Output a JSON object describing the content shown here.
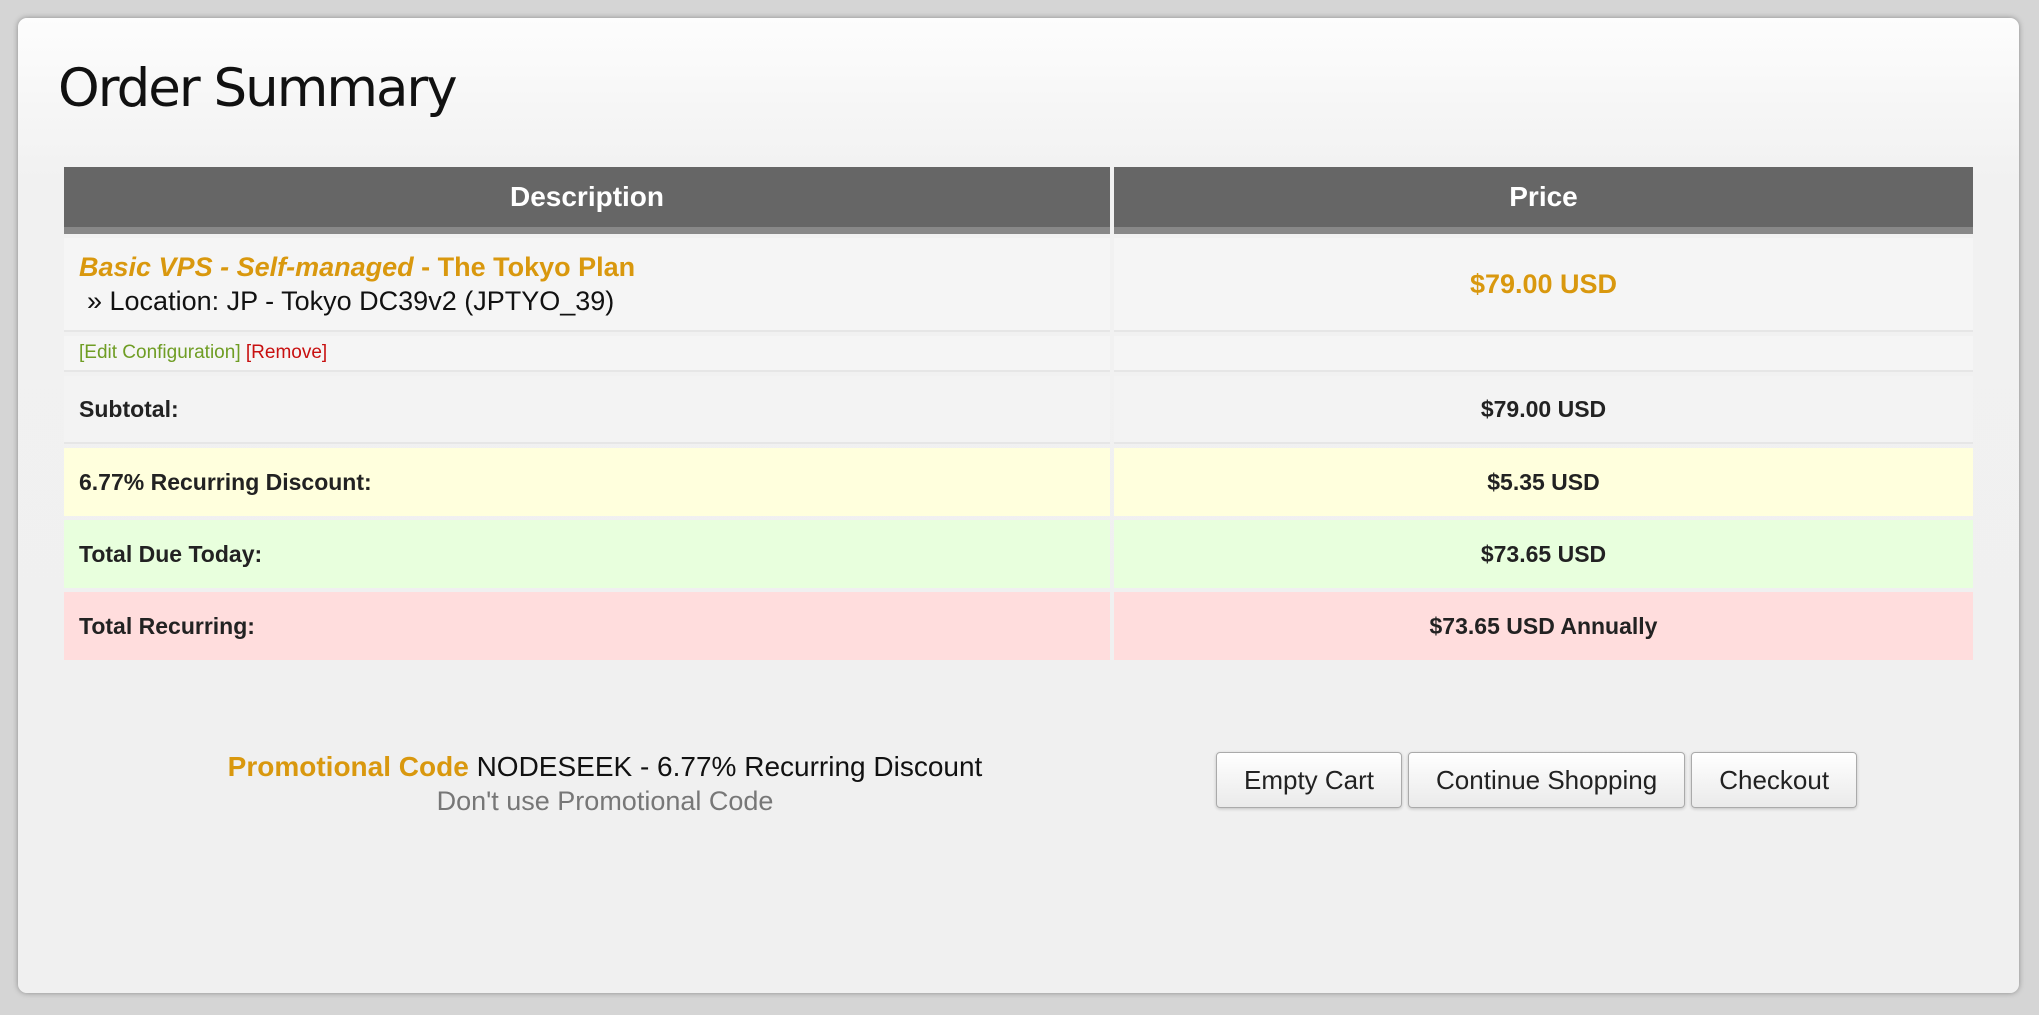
{
  "page": {
    "title": "Order Summary"
  },
  "table": {
    "headers": {
      "description": "Description",
      "price": "Price"
    },
    "item": {
      "product_name": "Basic VPS - Self-managed",
      "product_separator": " - ",
      "plan_name": "The Tokyo Plan",
      "config_line": "» Location: JP - Tokyo DC39v2 (JPTYO_39)",
      "price": "$79.00 USD",
      "actions": {
        "edit_label": "[Edit Configuration]",
        "remove_label": "[Remove]"
      }
    },
    "summary": {
      "subtotal": {
        "label": "Subtotal:",
        "value": "$79.00 USD"
      },
      "discount": {
        "label": "6.77% Recurring Discount:",
        "value": "$5.35 USD"
      },
      "total_due": {
        "label": "Total Due Today:",
        "value": "$73.65 USD"
      },
      "total_recurring": {
        "label": "Total Recurring:",
        "value": "$73.65 USD Annually"
      }
    }
  },
  "promo": {
    "label": "Promotional Code",
    "code_text": "NODESEEK - 6.77% Recurring Discount",
    "remove_link": "Don't use Promotional Code"
  },
  "buttons": {
    "empty_cart": "Empty Cart",
    "continue_shopping": "Continue Shopping",
    "checkout": "Checkout"
  },
  "colors": {
    "accent": "#d9980e",
    "header_bg": "#666666",
    "edit_link": "#6f9d24",
    "remove_link": "#c81010",
    "discount_bg": "#ffffdd",
    "due_bg": "#e8ffdd",
    "recurring_bg": "#ffdddd"
  }
}
